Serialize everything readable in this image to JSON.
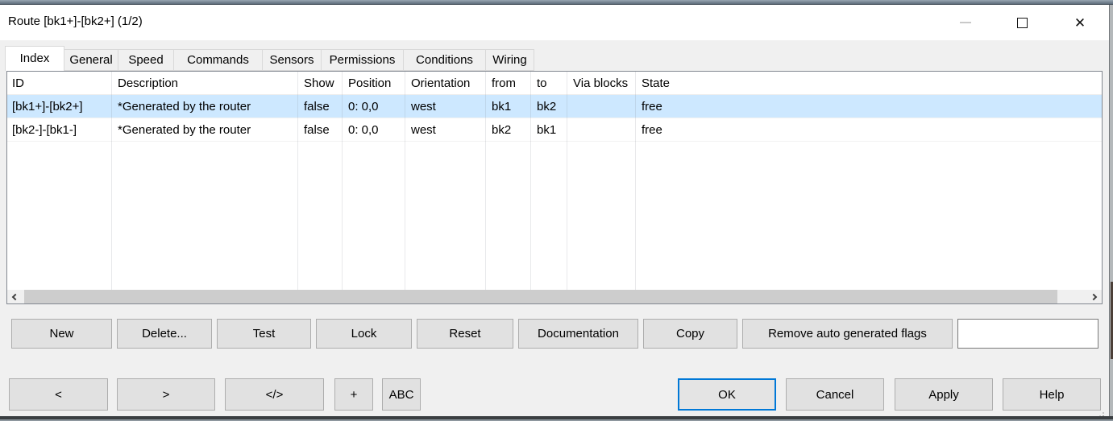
{
  "window": {
    "title": "Route [bk1+]-[bk2+] (1/2)"
  },
  "tabs": [
    {
      "label": "Index",
      "active": true
    },
    {
      "label": "General",
      "active": false
    },
    {
      "label": "Speed",
      "active": false
    },
    {
      "label": "Commands",
      "active": false
    },
    {
      "label": "Sensors",
      "active": false
    },
    {
      "label": "Permissions",
      "active": false
    },
    {
      "label": "Conditions",
      "active": false
    },
    {
      "label": "Wiring",
      "active": false
    }
  ],
  "table": {
    "columns": [
      "ID",
      "Description",
      "Show",
      "Position",
      "Orientation",
      "from",
      "to",
      "Via blocks",
      "State"
    ],
    "rows": [
      {
        "selected": true,
        "cells": [
          "[bk1+]-[bk2+]",
          "*Generated by the router",
          "false",
          "0: 0,0",
          "west",
          "bk1",
          "bk2",
          "",
          "free"
        ]
      },
      {
        "selected": false,
        "cells": [
          "[bk2-]-[bk1-]",
          "*Generated by the router",
          "false",
          "0: 0,0",
          "west",
          "bk2",
          "bk1",
          "",
          "free"
        ]
      }
    ]
  },
  "action_buttons": {
    "new": "New",
    "delete": "Delete...",
    "test": "Test",
    "lock": "Lock",
    "reset": "Reset",
    "documentation": "Documentation",
    "copy": "Copy",
    "remove_flags": "Remove auto generated flags"
  },
  "filter_input": {
    "value": ""
  },
  "nav_buttons": {
    "prev": "<",
    "next": ">",
    "code": "</>",
    "plus": "+",
    "abc": "ABC"
  },
  "dialog_buttons": {
    "ok": "OK",
    "cancel": "Cancel",
    "apply": "Apply",
    "help": "Help"
  },
  "colors": {
    "selection": "#cde8ff",
    "accent": "#0078d7",
    "dialog_bg": "#f0f0f0"
  }
}
